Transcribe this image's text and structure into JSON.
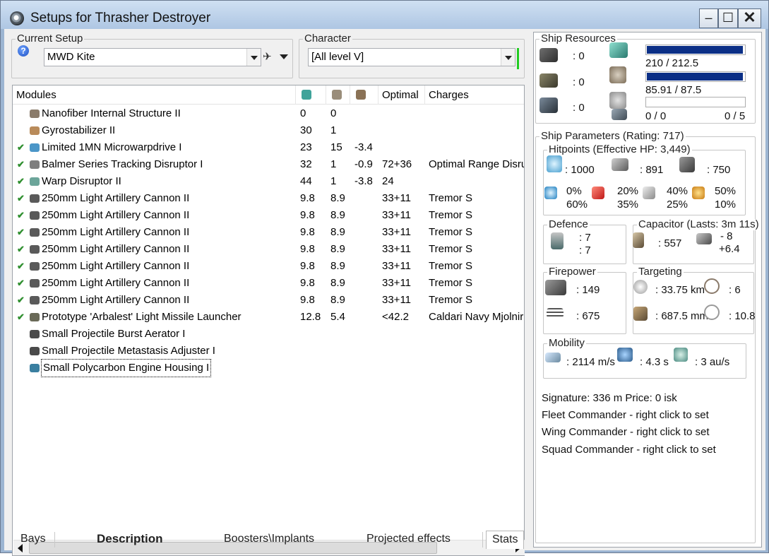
{
  "window": {
    "title": "Setups for Thrasher Destroyer",
    "min_icon": "minimize-icon",
    "max_icon": "maximize-icon",
    "close_icon": "close-icon"
  },
  "current_setup": {
    "label": "Current Setup",
    "value": "MWD Kite"
  },
  "character": {
    "label": "Character",
    "value": "[All level V]"
  },
  "modules": {
    "headers": {
      "name": "Modules",
      "col1_icon": "cpu-icon",
      "col2_icon": "powergrid-icon",
      "col3_icon": "capacitor-icon",
      "optimal": "Optimal",
      "charges": "Charges"
    },
    "rows": [
      {
        "check": "",
        "name": "Nanofiber Internal Structure II",
        "cpu": "0",
        "pg": "0",
        "cap": "",
        "optimal": "",
        "charges": "",
        "icon_color": "#8a7b6a"
      },
      {
        "check": "",
        "name": "Gyrostabilizer II",
        "cpu": "30",
        "pg": "1",
        "cap": "",
        "optimal": "",
        "charges": "",
        "icon_color": "#b98b5a"
      },
      {
        "check": "✔",
        "name": "Limited 1MN Microwarpdrive I",
        "cpu": "23",
        "pg": "15",
        "cap": "-3.4",
        "optimal": "",
        "charges": "",
        "icon_color": "#4b96c8"
      },
      {
        "check": "✔",
        "name": "Balmer Series Tracking Disruptor I",
        "cpu": "32",
        "pg": "1",
        "cap": "-0.9",
        "optimal": "72+36",
        "charges": "Optimal Range Disruption",
        "icon_color": "#7e7e7e"
      },
      {
        "check": "✔",
        "name": "Warp Disruptor II",
        "cpu": "44",
        "pg": "1",
        "cap": "-3.8",
        "optimal": "24",
        "charges": "",
        "icon_color": "#6ca59a"
      },
      {
        "check": "✔",
        "name": "250mm Light Artillery Cannon II",
        "cpu": "9.8",
        "pg": "8.9",
        "cap": "",
        "optimal": "33+11",
        "charges": "Tremor S",
        "icon_color": "#5a5a5a"
      },
      {
        "check": "✔",
        "name": "250mm Light Artillery Cannon II",
        "cpu": "9.8",
        "pg": "8.9",
        "cap": "",
        "optimal": "33+11",
        "charges": "Tremor S",
        "icon_color": "#5a5a5a"
      },
      {
        "check": "✔",
        "name": "250mm Light Artillery Cannon II",
        "cpu": "9.8",
        "pg": "8.9",
        "cap": "",
        "optimal": "33+11",
        "charges": "Tremor S",
        "icon_color": "#5a5a5a"
      },
      {
        "check": "✔",
        "name": "250mm Light Artillery Cannon II",
        "cpu": "9.8",
        "pg": "8.9",
        "cap": "",
        "optimal": "33+11",
        "charges": "Tremor S",
        "icon_color": "#5a5a5a"
      },
      {
        "check": "✔",
        "name": "250mm Light Artillery Cannon II",
        "cpu": "9.8",
        "pg": "8.9",
        "cap": "",
        "optimal": "33+11",
        "charges": "Tremor S",
        "icon_color": "#5a5a5a"
      },
      {
        "check": "✔",
        "name": "250mm Light Artillery Cannon II",
        "cpu": "9.8",
        "pg": "8.9",
        "cap": "",
        "optimal": "33+11",
        "charges": "Tremor S",
        "icon_color": "#5a5a5a"
      },
      {
        "check": "✔",
        "name": "250mm Light Artillery Cannon II",
        "cpu": "9.8",
        "pg": "8.9",
        "cap": "",
        "optimal": "33+11",
        "charges": "Tremor S",
        "icon_color": "#5a5a5a"
      },
      {
        "check": "✔",
        "name": "Prototype 'Arbalest' Light Missile Launcher",
        "cpu": "12.8",
        "pg": "5.4",
        "cap": "",
        "optimal": "<42.2",
        "charges": "Caldari Navy Mjolnir Light Missile",
        "icon_color": "#6a6a58"
      },
      {
        "check": "",
        "name": "Small Projectile Burst Aerator I",
        "cpu": "",
        "pg": "",
        "cap": "",
        "optimal": "",
        "charges": "",
        "icon_color": "#4a4a4a"
      },
      {
        "check": "",
        "name": "Small Projectile Metastasis Adjuster I",
        "cpu": "",
        "pg": "",
        "cap": "",
        "optimal": "",
        "charges": "",
        "icon_color": "#4a4a4a"
      },
      {
        "check": "",
        "name": "Small Polycarbon Engine Housing I",
        "cpu": "",
        "pg": "",
        "cap": "",
        "optimal": "",
        "charges": "",
        "icon_color": "#3a7fa0"
      }
    ]
  },
  "tabs": [
    "Bays",
    "Description",
    "Boosters\\Implants",
    "Projected effects",
    "Stats"
  ],
  "resources": {
    "label": "Ship Resources",
    "hardpoint_turret": ": 0",
    "hardpoint_launcher": ": 0",
    "hardpoint_rig": ": 0",
    "cpu_text": "210 / 212.5",
    "cpu_frac": 0.988,
    "pg_text": "85.91 / 87.5",
    "pg_frac": 0.982,
    "calib_text": "0 / 0",
    "drones_text": "0 / 5",
    "calib_frac": 0
  },
  "params": {
    "label": "Ship Parameters (Rating: 717)",
    "hitpoints_label": "Hitpoints (Effective HP: 3,449)",
    "shield_hp": ": 1000",
    "armor_hp": ": 891",
    "structure_hp": ": 750",
    "res_em": "0%",
    "res_em2": "60%",
    "res_th": "20%",
    "res_th2": "35%",
    "res_kin": "40%",
    "res_kin2": "25%",
    "res_exp": "50%",
    "res_exp2": "10%",
    "defence_label": "Defence",
    "def1": ": 7",
    "def2": ": 7",
    "capacitor_label": "Capacitor (Lasts: 3m 11s)",
    "cap_amount": ": 557",
    "cap_delta1": "- 8",
    "cap_delta2": "+6.4",
    "firepower_label": "Firepower",
    "fp1": ": 149",
    "fp2": ": 675",
    "targeting_label": "Targeting",
    "tgt_range": ": 33.75 km",
    "tgt_count": ": 6",
    "tgt_res": ": 687.5 mm",
    "tgt_sensor": ": 10.8",
    "mobility_label": "Mobility",
    "speed": ": 2114 m/s",
    "align": ": 4.3 s",
    "warp": ": 3 au/s"
  },
  "info": {
    "signature": "Signature: 336 m  Price: 0 isk",
    "fleet": "Fleet Commander - right click to set",
    "wing": "Wing Commander - right click to set",
    "squad": "Squad Commander - right click to set"
  }
}
